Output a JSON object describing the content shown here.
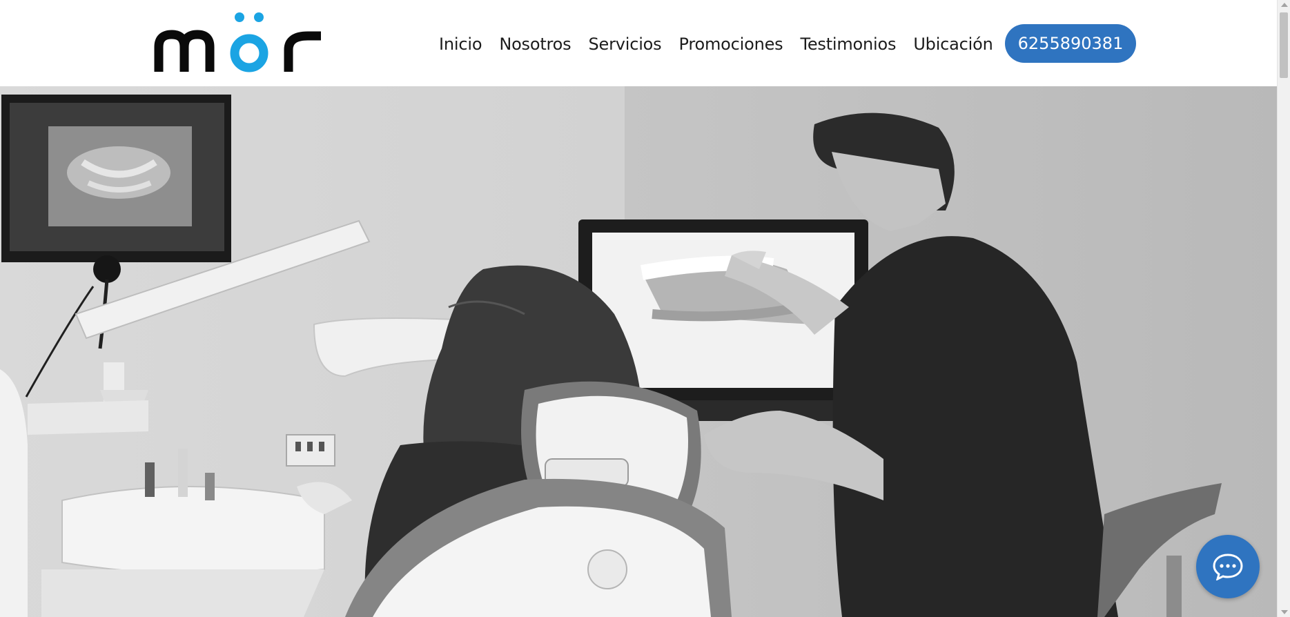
{
  "brand": {
    "logo_text": "mör",
    "accent_color": "#1ba4e3",
    "primary_color": "#2f74c0"
  },
  "nav": {
    "items": [
      {
        "label": "Inicio"
      },
      {
        "label": "Nosotros"
      },
      {
        "label": "Servicios"
      },
      {
        "label": "Promociones"
      },
      {
        "label": "Testimonios"
      },
      {
        "label": "Ubicación"
      }
    ],
    "phone_label": "6255890381"
  },
  "hero": {
    "image": "grayscale photo of a dentist showing a 3D dental scan on a monitor to a patient in a dental chair"
  },
  "chat": {
    "icon": "chat-bubble-icon"
  }
}
